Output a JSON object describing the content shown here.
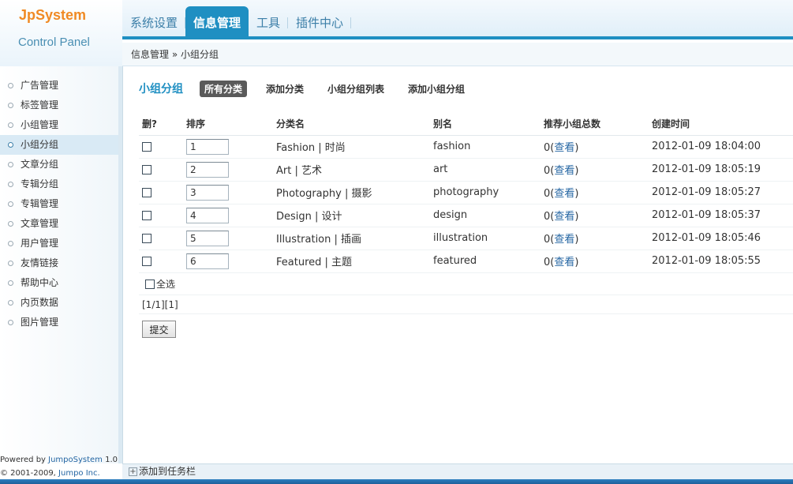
{
  "logo": {
    "title": "JpSystem",
    "subtitle": "Control Panel"
  },
  "nav": {
    "items": [
      {
        "label": "系统设置",
        "active": false
      },
      {
        "label": "信息管理",
        "active": true
      },
      {
        "label": "工具",
        "active": false
      },
      {
        "label": "插件中心",
        "active": false
      }
    ]
  },
  "breadcrumb": "信息管理 » 小组分组",
  "sidebar": {
    "items": [
      {
        "label": "广告管理",
        "active": false
      },
      {
        "label": "标签管理",
        "active": false
      },
      {
        "label": "小组管理",
        "active": false
      },
      {
        "label": "小组分组",
        "active": true
      },
      {
        "label": "文章分组",
        "active": false
      },
      {
        "label": "专辑分组",
        "active": false
      },
      {
        "label": "专辑管理",
        "active": false
      },
      {
        "label": "文章管理",
        "active": false
      },
      {
        "label": "用户管理",
        "active": false
      },
      {
        "label": "友情链接",
        "active": false
      },
      {
        "label": "帮助中心",
        "active": false
      },
      {
        "label": "内页数据",
        "active": false
      },
      {
        "label": "图片管理",
        "active": false
      }
    ],
    "powered_prefix": "Powered by ",
    "powered_link": "JumpoSystem",
    "powered_version": " 1.0",
    "copyright_prefix": "© 2001-2009, ",
    "copyright_link": "Jumpo Inc."
  },
  "main": {
    "title": "小组分组",
    "subtabs": [
      {
        "label": "所有分类",
        "active": true
      },
      {
        "label": "添加分类",
        "active": false
      },
      {
        "label": "小组分组列表",
        "active": false
      },
      {
        "label": "添加小组分组",
        "active": false
      }
    ],
    "columns": [
      "删?",
      "排序",
      "分类名",
      "别名",
      "推荐小组总数",
      "创建时间"
    ],
    "rows": [
      {
        "sort": "1",
        "name": "Fashion | 时尚",
        "alias": "fashion",
        "count": "0",
        "view": "查看",
        "created": "2012-01-09 18:04:00"
      },
      {
        "sort": "2",
        "name": "Art | 艺术",
        "alias": "art",
        "count": "0",
        "view": "查看",
        "created": "2012-01-09 18:05:19"
      },
      {
        "sort": "3",
        "name": "Photography | 摄影",
        "alias": "photography",
        "count": "0",
        "view": "查看",
        "created": "2012-01-09 18:05:27"
      },
      {
        "sort": "4",
        "name": "Design | 设计",
        "alias": "design",
        "count": "0",
        "view": "查看",
        "created": "2012-01-09 18:05:37"
      },
      {
        "sort": "5",
        "name": "Illustration | 插画",
        "alias": "illustration",
        "count": "0",
        "view": "查看",
        "created": "2012-01-09 18:05:46"
      },
      {
        "sort": "6",
        "name": "Featured | 主题",
        "alias": "featured",
        "count": "0",
        "view": "查看",
        "created": "2012-01-09 18:05:55"
      }
    ],
    "select_all": "全选",
    "pager": "[1/1][1]",
    "submit": "提交"
  },
  "footer": {
    "add_to_taskbar": "添加到任务栏"
  },
  "colors": {
    "accent": "#1f8fc2",
    "logo": "#f08a24",
    "link": "#2566a3"
  }
}
